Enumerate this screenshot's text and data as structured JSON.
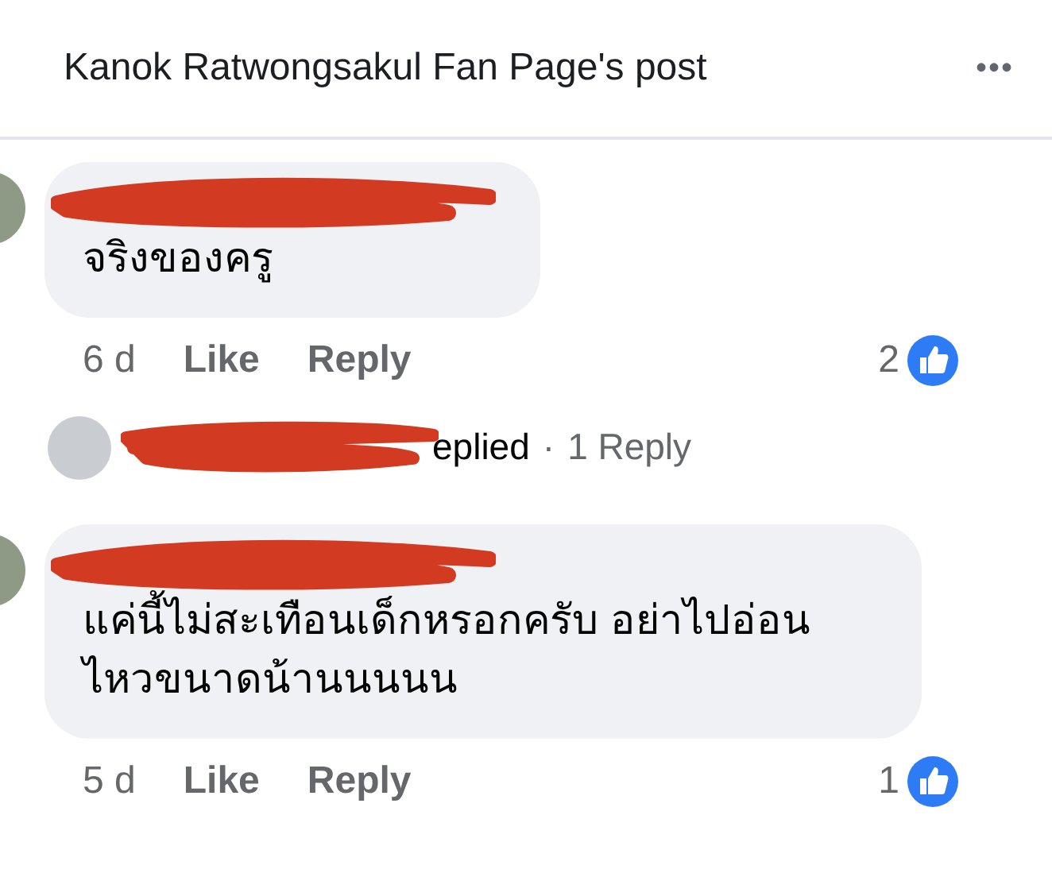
{
  "header": {
    "title": "Kanok Ratwongsakul Fan Page's post",
    "more": "•••"
  },
  "items": [
    {
      "kind": "comment",
      "text": "จริงของครู",
      "time": "6 d",
      "like": "Like",
      "reply": "Reply",
      "reactions": "2"
    },
    {
      "kind": "replies",
      "text": "eplied",
      "separator": "·",
      "link": "1 Reply"
    },
    {
      "kind": "comment",
      "text": "แค่นี้ไม่สะเทือนเด็กหรอกครับ อย่าไปอ่อนไหวขนาดน้านนนนน",
      "time": "5 d",
      "like": "Like",
      "reply": "Reply",
      "reactions": "1"
    }
  ]
}
